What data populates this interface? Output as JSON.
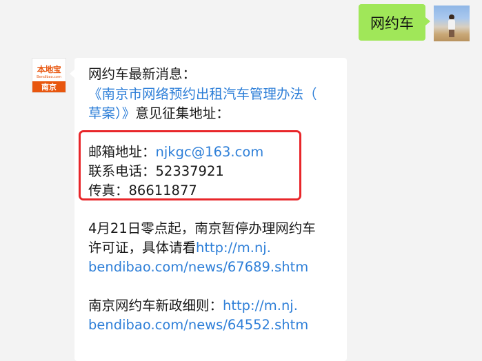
{
  "outgoing": {
    "text": "网约车"
  },
  "account": {
    "logo_text": "本地宝",
    "logo_url": "Bendibao.com",
    "city": "南京"
  },
  "message": {
    "intro": "网约车最新消息：",
    "title_line1": "《南京市网络预约出租汽车管理办法（",
    "title_line2_link": "草案）》",
    "title_line2_text": "意见征集地址：",
    "email_label": "邮箱地址：",
    "email_value": "njkgc@163.com",
    "phone_label": "联系电话：",
    "phone_value": "52337921",
    "fax_label": "传真：",
    "fax_value": "86611877",
    "notice_line1": "4月21日零点起，南京暂停办理网约车",
    "notice_line2_text": "许可证，具体请看",
    "notice_line2_link": "http://m.nj.",
    "notice_line3_link": "bendibao.com/news/67689.shtm",
    "policy_line1_text": "南京网约车新政细则：",
    "policy_line1_link": "http://m.nj.",
    "policy_line2_link": "bendibao.com/news/64552.shtm"
  },
  "colors": {
    "outgoing_bubble": "#a0e759",
    "link": "#2e7fd8",
    "highlight_border": "#e8262a",
    "brand_orange": "#e8560e"
  }
}
